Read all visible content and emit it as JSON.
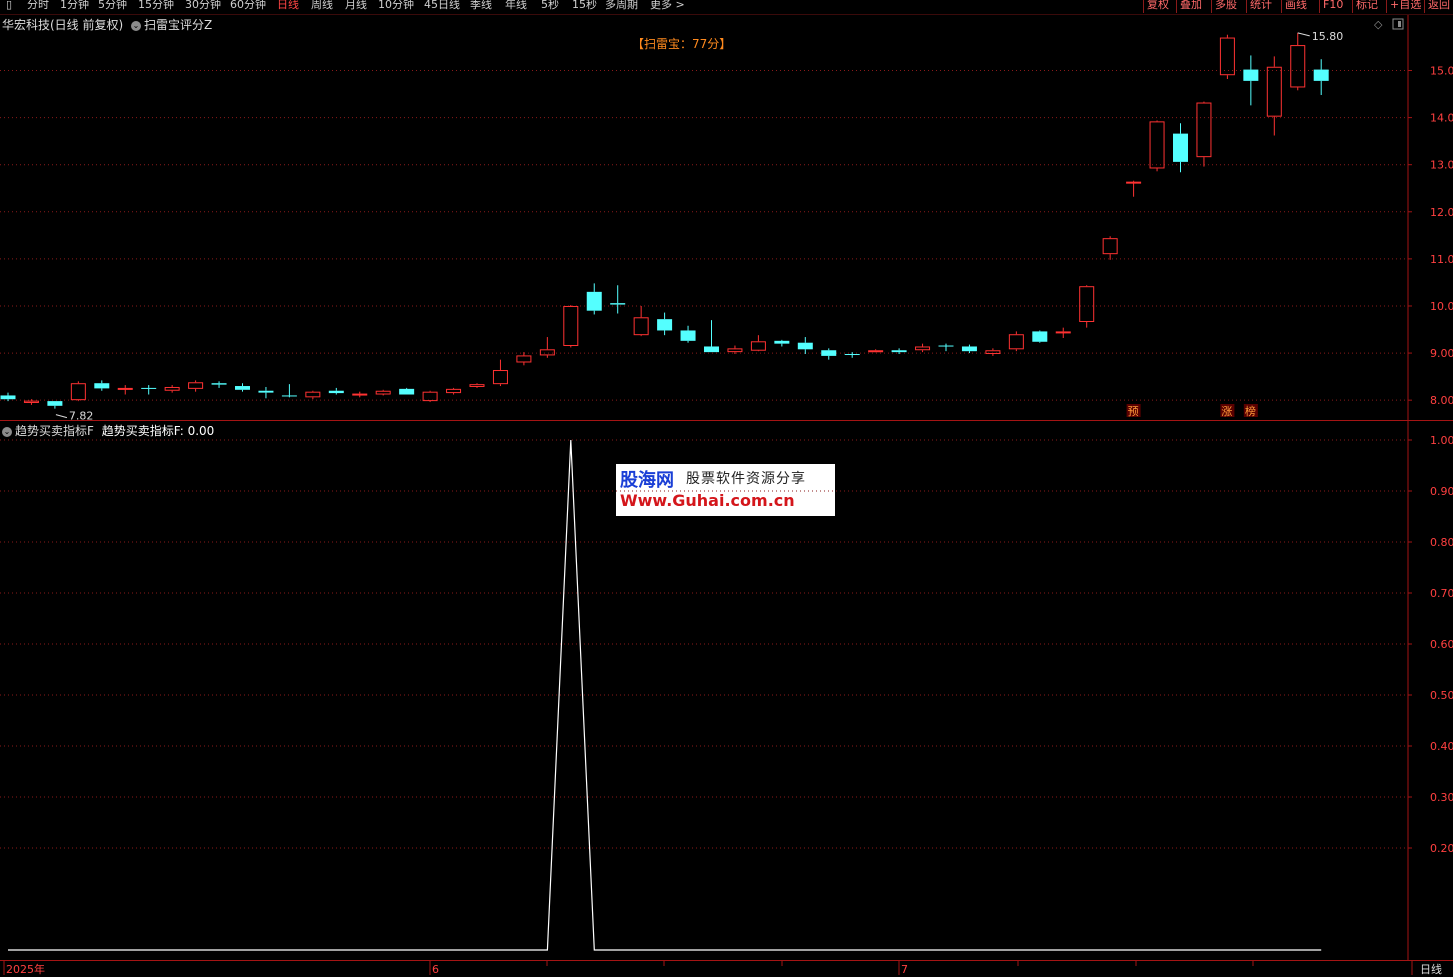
{
  "toolbar": {
    "periods": [
      "分时",
      "1分钟",
      "5分钟",
      "15分钟",
      "30分钟",
      "60分钟",
      "日线",
      "周线",
      "月线",
      "10分钟",
      "45日线",
      "季线",
      "年线",
      "5秒",
      "15秒",
      "多周期",
      "更多 >"
    ],
    "active": "日线",
    "right_buttons": [
      "复权",
      "叠加",
      "多股",
      "统计",
      "画线",
      "F10",
      "标记",
      "+自选",
      "返回"
    ]
  },
  "main": {
    "stock_label": "华宏科技(日线 前复权)",
    "formula": "扫雷宝评分Z",
    "score": "【扫雷宝：77分】",
    "high_label": "15.80",
    "low_label": "7.82",
    "markers": [
      "预",
      "涨",
      "榜"
    ],
    "icons": [
      "diamond-icon",
      "window-icon"
    ]
  },
  "indicator": {
    "name": "趋势买卖指标F",
    "value_text": "趋势买卖指标F: 0.00"
  },
  "watermark": {
    "logo": "股海网",
    "slogan": "股票软件资源分享",
    "url": "Www.Guhai.com.cn"
  },
  "time_axis": {
    "labels": [
      "2025年",
      "6",
      "7"
    ]
  },
  "footer": {
    "period": "日线"
  },
  "colors": {
    "up": "#ff3232",
    "down": "#54ffff",
    "grid": "#8a1a1a",
    "axis": "#a51414",
    "line": "#ffffff"
  },
  "chart_data": [
    {
      "type": "candlestick",
      "y_ticks": [
        "8.00",
        "9.00",
        "10.00",
        "11.00",
        "12.00",
        "13.00",
        "14.00",
        "15.00"
      ],
      "ylim": [
        7.6,
        16.2
      ],
      "candles": [
        {
          "o": 8.1,
          "h": 8.16,
          "l": 7.98,
          "c": 8.02
        },
        {
          "o": 7.94,
          "h": 8.02,
          "l": 7.9,
          "c": 7.99
        },
        {
          "o": 7.98,
          "h": 7.98,
          "l": 7.82,
          "c": 7.88
        },
        {
          "o": 8.0,
          "h": 8.4,
          "l": 7.98,
          "c": 8.36
        },
        {
          "o": 8.36,
          "h": 8.42,
          "l": 8.2,
          "c": 8.25
        },
        {
          "o": 8.24,
          "h": 8.32,
          "l": 8.12,
          "c": 8.26
        },
        {
          "o": 8.26,
          "h": 8.32,
          "l": 8.12,
          "c": 8.25
        },
        {
          "o": 8.2,
          "h": 8.32,
          "l": 8.16,
          "c": 8.28
        },
        {
          "o": 8.24,
          "h": 8.42,
          "l": 8.18,
          "c": 8.38
        },
        {
          "o": 8.36,
          "h": 8.4,
          "l": 8.26,
          "c": 8.33
        },
        {
          "o": 8.3,
          "h": 8.36,
          "l": 8.18,
          "c": 8.22
        },
        {
          "o": 8.2,
          "h": 8.28,
          "l": 8.04,
          "c": 8.16
        },
        {
          "o": 8.1,
          "h": 8.34,
          "l": 8.06,
          "c": 8.09
        },
        {
          "o": 8.06,
          "h": 8.2,
          "l": 8.02,
          "c": 8.18
        },
        {
          "o": 8.2,
          "h": 8.26,
          "l": 8.12,
          "c": 8.15
        },
        {
          "o": 8.12,
          "h": 8.18,
          "l": 8.06,
          "c": 8.14
        },
        {
          "o": 8.12,
          "h": 8.22,
          "l": 8.1,
          "c": 8.2
        },
        {
          "o": 8.24,
          "h": 8.26,
          "l": 8.12,
          "c": 8.12
        },
        {
          "o": 7.98,
          "h": 8.2,
          "l": 7.96,
          "c": 8.18
        },
        {
          "o": 8.15,
          "h": 8.26,
          "l": 8.12,
          "c": 8.24
        },
        {
          "o": 8.28,
          "h": 8.36,
          "l": 8.26,
          "c": 8.34
        },
        {
          "o": 8.34,
          "h": 8.86,
          "l": 8.3,
          "c": 8.64
        },
        {
          "o": 8.8,
          "h": 9.02,
          "l": 8.74,
          "c": 8.95
        },
        {
          "o": 8.95,
          "h": 9.34,
          "l": 8.9,
          "c": 9.08
        },
        {
          "o": 9.15,
          "h": 10.02,
          "l": 9.12,
          "c": 10.0
        },
        {
          "o": 10.3,
          "h": 10.48,
          "l": 9.82,
          "c": 9.9
        },
        {
          "o": 10.06,
          "h": 10.44,
          "l": 9.84,
          "c": 10.03
        },
        {
          "o": 9.38,
          "h": 10.0,
          "l": 9.36,
          "c": 9.76
        },
        {
          "o": 9.72,
          "h": 9.86,
          "l": 9.38,
          "c": 9.48
        },
        {
          "o": 9.48,
          "h": 9.58,
          "l": 9.22,
          "c": 9.26
        },
        {
          "o": 9.14,
          "h": 9.7,
          "l": 9.02,
          "c": 9.02
        },
        {
          "o": 9.02,
          "h": 9.16,
          "l": 8.98,
          "c": 9.1
        },
        {
          "o": 9.05,
          "h": 9.38,
          "l": 9.04,
          "c": 9.25
        },
        {
          "o": 9.26,
          "h": 9.28,
          "l": 9.14,
          "c": 9.2
        },
        {
          "o": 9.22,
          "h": 9.34,
          "l": 8.98,
          "c": 9.08
        },
        {
          "o": 9.06,
          "h": 9.1,
          "l": 8.86,
          "c": 8.94
        },
        {
          "o": 8.98,
          "h": 9.02,
          "l": 8.9,
          "c": 8.96
        },
        {
          "o": 9.04,
          "h": 9.08,
          "l": 9.02,
          "c": 9.06
        },
        {
          "o": 9.06,
          "h": 9.1,
          "l": 8.98,
          "c": 9.02
        },
        {
          "o": 9.06,
          "h": 9.2,
          "l": 9.02,
          "c": 9.14
        },
        {
          "o": 9.16,
          "h": 9.2,
          "l": 9.04,
          "c": 9.14
        },
        {
          "o": 9.14,
          "h": 9.18,
          "l": 9.0,
          "c": 9.04
        },
        {
          "o": 8.98,
          "h": 9.1,
          "l": 8.94,
          "c": 9.06
        },
        {
          "o": 9.08,
          "h": 9.46,
          "l": 9.04,
          "c": 9.4
        },
        {
          "o": 9.46,
          "h": 9.48,
          "l": 9.22,
          "c": 9.24
        },
        {
          "o": 9.46,
          "h": 9.54,
          "l": 9.32,
          "c": 9.46
        },
        {
          "o": 9.66,
          "h": 10.44,
          "l": 9.54,
          "c": 10.42
        },
        {
          "o": 11.1,
          "h": 11.48,
          "l": 10.98,
          "c": 11.44
        },
        {
          "o": 12.64,
          "h": 12.66,
          "l": 12.32,
          "c": 12.64
        },
        {
          "o": 12.92,
          "h": 13.94,
          "l": 12.86,
          "c": 13.92
        },
        {
          "o": 13.66,
          "h": 13.88,
          "l": 12.84,
          "c": 13.06
        },
        {
          "o": 13.16,
          "h": 14.34,
          "l": 12.96,
          "c": 14.32
        },
        {
          "o": 14.9,
          "h": 15.76,
          "l": 14.82,
          "c": 15.7
        },
        {
          "o": 15.02,
          "h": 15.32,
          "l": 14.26,
          "c": 14.78
        },
        {
          "o": 14.02,
          "h": 15.3,
          "l": 13.62,
          "c": 15.08
        },
        {
          "o": 14.64,
          "h": 15.8,
          "l": 14.58,
          "c": 15.54
        },
        {
          "o": 15.02,
          "h": 15.24,
          "l": 14.48,
          "c": 14.78
        }
      ]
    },
    {
      "type": "line",
      "y_ticks": [
        "0.20",
        "0.30",
        "0.40",
        "0.50",
        "0.60",
        "0.70",
        "0.80",
        "0.90",
        "1.00"
      ],
      "ylim": [
        0,
        1
      ],
      "x": [
        0,
        23,
        24,
        25,
        56
      ],
      "values": [
        0,
        0,
        1,
        0,
        0
      ]
    }
  ]
}
